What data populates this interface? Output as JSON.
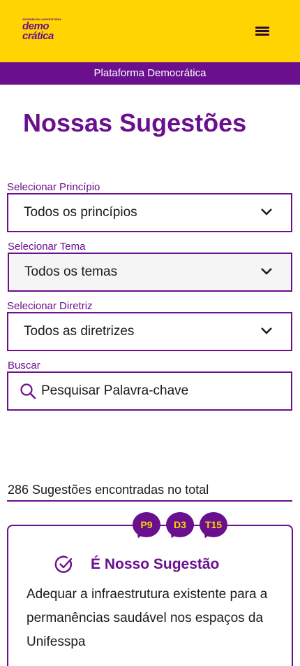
{
  "header": {
    "logo": {
      "tagline": "ASSEMBLEIA UNIVERSITÁRIA",
      "word1": "demo",
      "word2": "crática"
    },
    "menu_icon": "hamburger-menu-icon"
  },
  "banner": {
    "text": "Plataforma Democrática"
  },
  "page": {
    "title": "Nossas Sugestões"
  },
  "filters": {
    "principio": {
      "label": "Selecionar Princípio",
      "value": "Todos os princípios"
    },
    "tema": {
      "label": "Selecionar Tema",
      "value": "Todos os temas"
    },
    "diretriz": {
      "label": "Selecionar Diretriz",
      "value": "Todos as diretrizes"
    },
    "search": {
      "label": "Buscar",
      "placeholder": "Pesquisar Palavra-chave"
    }
  },
  "results": {
    "count_text": "286 Sugestões encontradas no total"
  },
  "cards": [
    {
      "tags": [
        "P9",
        "D3",
        "T15"
      ],
      "title": "É Nosso Sugestão",
      "text": "Adequar a infraestrutura existente para a permanências saudável nos espaços da Unifesspa"
    }
  ],
  "colors": {
    "brand_yellow": "#FFD400",
    "brand_purple": "#6a0f8e"
  }
}
